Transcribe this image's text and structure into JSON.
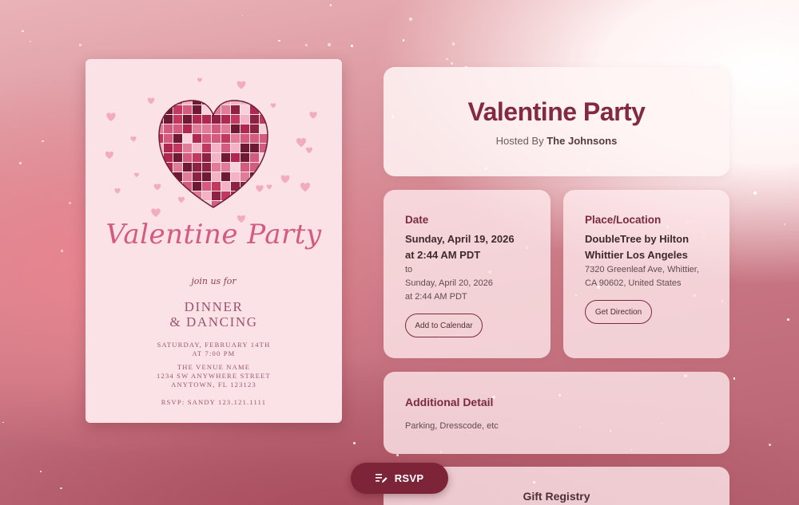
{
  "invitation": {
    "script_title": "Valentine Party",
    "join": "join us for",
    "dinner_line1": "DINNER",
    "dinner_line2": "& DANCING",
    "date_line": "SATURDAY, FEBRUARY 14TH",
    "time_line": "AT 7:00 PM",
    "venue_name": "THE VENUE NAME",
    "street": "1234 SW ANYWHERE STREET",
    "city": "ANYTOWN, FL 123123",
    "rsvp_line": "RSVP: SANDY 123.121.1111"
  },
  "event": {
    "title": "Valentine Party",
    "hosted_by_label": "Hosted By",
    "host": "The Johnsons"
  },
  "date": {
    "label": "Date",
    "start_date": "Sunday, April 19, 2026",
    "start_time": "at 2:44 AM PDT",
    "to": "to",
    "end_date": "Sunday, April 20, 2026",
    "end_time": "at 2:44 AM PDT",
    "button": "Add to Calendar"
  },
  "location": {
    "label": "Place/Location",
    "venue_line1": "DoubleTree by Hilton",
    "venue_line2": "Whittier Los Angeles",
    "address_line1": "7320 Greenleaf Ave, Whittier,",
    "address_line2": "CA 90602, United States",
    "button": "Get Direction"
  },
  "details": {
    "label": "Additional Detail",
    "text": "Parking, Dresscode, etc"
  },
  "gift": {
    "label": "Gift Registry"
  },
  "rsvp": {
    "label": "RSVP",
    "icon": "edit-list-icon"
  },
  "colors": {
    "accent": "#7d2438",
    "title": "#822a3f",
    "card": "#fbe2e6",
    "script": "#d45a7e"
  }
}
